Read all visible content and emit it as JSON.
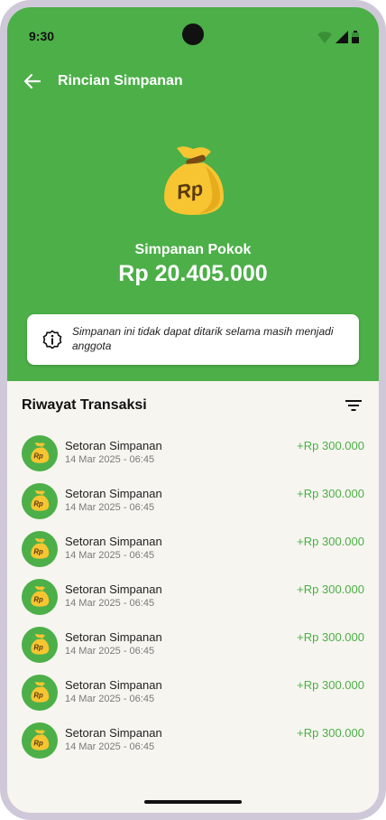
{
  "status_bar": {
    "time": "9:30"
  },
  "appbar": {
    "title": "Rincian Simpanan",
    "back_icon": "arrow-left-icon"
  },
  "balance": {
    "icon": "money-bag-icon",
    "bag_text": "Rp",
    "label": "Simpanan Pokok",
    "value": "Rp 20.405.000"
  },
  "notice": {
    "icon": "info-icon",
    "text": "Simpanan ini tidak dapat ditarik selama masih menjadi anggota"
  },
  "history": {
    "title": "Riwayat Transaksi",
    "filter_icon": "filter-icon",
    "items": [
      {
        "title": "Setoran Simpanan",
        "date": "14 Mar 2025 - 06:45",
        "amount": "+Rp 300.000"
      },
      {
        "title": "Setoran Simpanan",
        "date": "14 Mar 2025 - 06:45",
        "amount": "+Rp 300.000"
      },
      {
        "title": "Setoran Simpanan",
        "date": "14 Mar 2025 - 06:45",
        "amount": "+Rp 300.000"
      },
      {
        "title": "Setoran Simpanan",
        "date": "14 Mar 2025 - 06:45",
        "amount": "+Rp 300.000"
      },
      {
        "title": "Setoran Simpanan",
        "date": "14 Mar 2025 - 06:45",
        "amount": "+Rp 300.000"
      },
      {
        "title": "Setoran Simpanan",
        "date": "14 Mar 2025 - 06:45",
        "amount": "+Rp 300.000"
      },
      {
        "title": "Setoran Simpanan",
        "date": "14 Mar 2025 - 06:45",
        "amount": "+Rp 300.000"
      }
    ]
  },
  "colors": {
    "primary_green": "#4caf48",
    "background": "#f6f5ef",
    "amount_green": "#4caf48",
    "bag_yellow": "#f7c531"
  }
}
